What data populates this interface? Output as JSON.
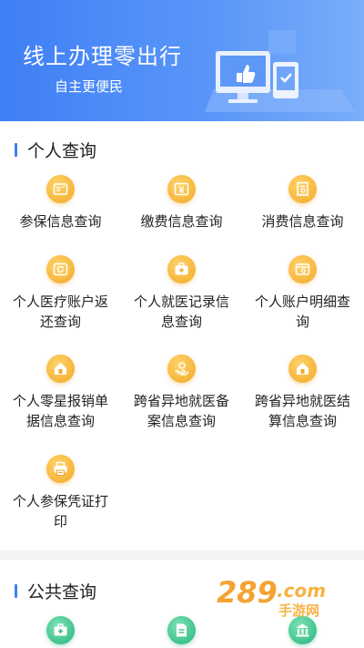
{
  "banner": {
    "title": "线上办理零出行",
    "subtitle": "自主更便民"
  },
  "personal": {
    "heading": "个人查询",
    "items": [
      {
        "label": "参保信息查询",
        "icon": "id-card-icon"
      },
      {
        "label": "缴费信息查询",
        "icon": "yen-card-icon"
      },
      {
        "label": "消费信息查询",
        "icon": "receipt-icon"
      },
      {
        "label": "个人医疗账户返还查询",
        "icon": "refresh-wallet-icon"
      },
      {
        "label": "个人就医记录信息查询",
        "icon": "medical-kit-icon"
      },
      {
        "label": "个人账户明细查询",
        "icon": "account-detail-icon"
      },
      {
        "label": "个人零星报销单据信息查询",
        "icon": "home-document-icon"
      },
      {
        "label": "跨省异地就医备案信息查询",
        "icon": "hand-money-icon"
      },
      {
        "label": "跨省异地就医结算信息查询",
        "icon": "home-settlement-icon"
      },
      {
        "label": "个人参保凭证打印",
        "icon": "printer-icon"
      }
    ]
  },
  "public": {
    "heading": "公共查询",
    "items": [
      {
        "label": "",
        "icon": "medical-box-icon"
      },
      {
        "label": "",
        "icon": "document-icon"
      },
      {
        "label": "",
        "icon": "institution-icon"
      }
    ]
  },
  "watermark": {
    "brand": "289",
    "domain": "com",
    "tagline": "手游网"
  },
  "colors": {
    "accent": "#3f7ff6",
    "icon_orange": "#f6b53a",
    "icon_green": "#3fc28c"
  }
}
